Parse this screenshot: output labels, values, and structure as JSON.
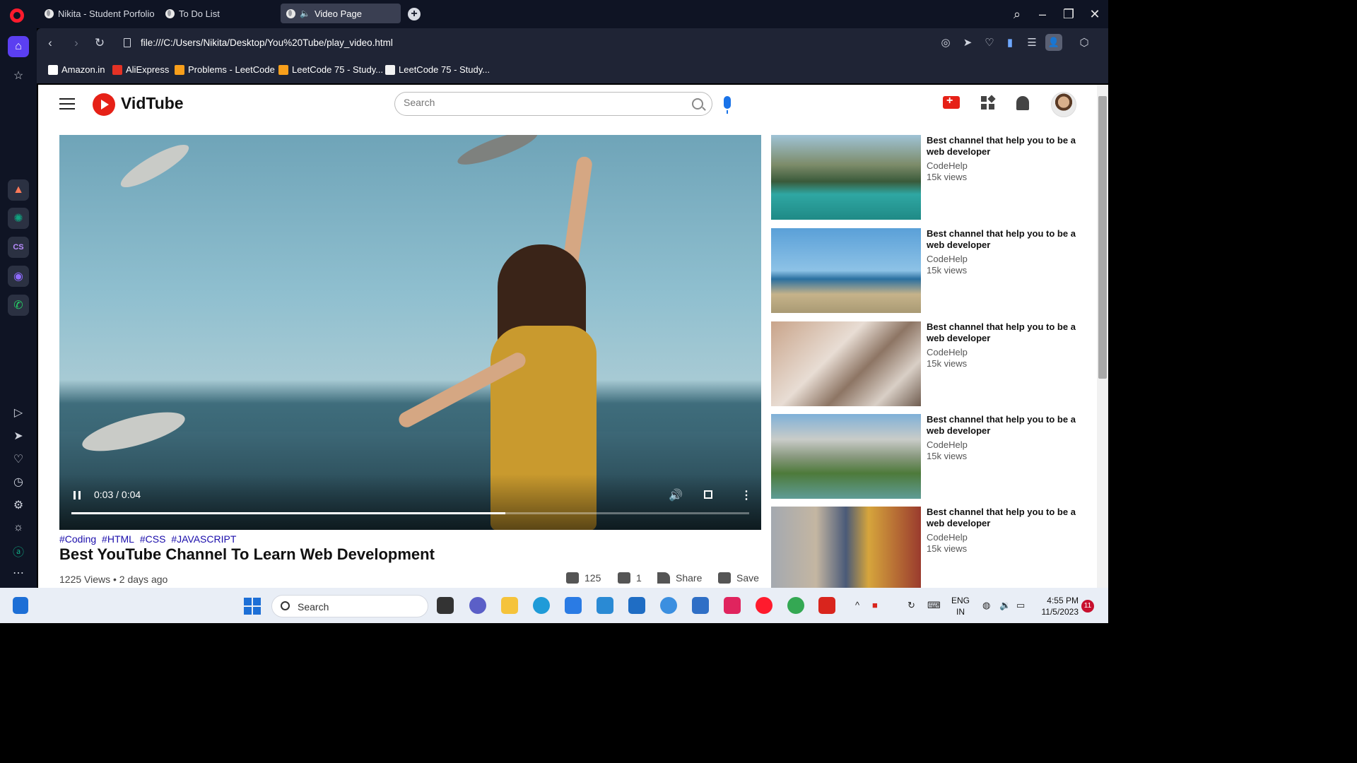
{
  "browser": {
    "tabs": [
      {
        "label": "Nikita - Student Porfolio"
      },
      {
        "label": "To Do List"
      },
      {
        "label": "Video Page"
      }
    ],
    "url": "file:///C:/Users/Nikita/Desktop/You%20Tube/play_video.html",
    "bookmarks": [
      {
        "label": "Amazon.in"
      },
      {
        "label": "AliExpress"
      },
      {
        "label": "Problems - LeetCode"
      },
      {
        "label": "LeetCode 75 - Study..."
      },
      {
        "label": "LeetCode 75 - Study..."
      }
    ]
  },
  "site": {
    "logo": "VidTube",
    "search_placeholder": "Search"
  },
  "video": {
    "time": "0:03 / 0:04",
    "progress": 0.64,
    "tags": [
      "#Coding",
      "#HTML",
      "#CSS",
      "#JAVASCRIPT"
    ],
    "title": "Best YouTube Channel To Learn Web Development",
    "meta": "1225 Views • 2 days ago",
    "likes": "125",
    "dislikes": "1",
    "share_label": "Share",
    "save_label": "Save"
  },
  "suggestions": [
    {
      "title": "Best channel that help you to be a web developer",
      "channel": "CodeHelp",
      "views": "15k views"
    },
    {
      "title": "Best channel that help you to be a web developer",
      "channel": "CodeHelp",
      "views": "15k views"
    },
    {
      "title": "Best channel that help you to be a web developer",
      "channel": "CodeHelp",
      "views": "15k views"
    },
    {
      "title": "Best channel that help you to be a web developer",
      "channel": "CodeHelp",
      "views": "15k views"
    },
    {
      "title": "Best channel that help you to be a web developer",
      "channel": "CodeHelp",
      "views": "15k views"
    }
  ],
  "taskbar": {
    "search_label": "Search",
    "lang_line1": "ENG",
    "lang_line2": "IN",
    "time": "4:55 PM",
    "date": "11/5/2023",
    "notifications": "11"
  },
  "colors": {
    "brand_red": "#e62117",
    "tag_link": "#1a0dab",
    "opera_accent": "#5b3ff1"
  }
}
